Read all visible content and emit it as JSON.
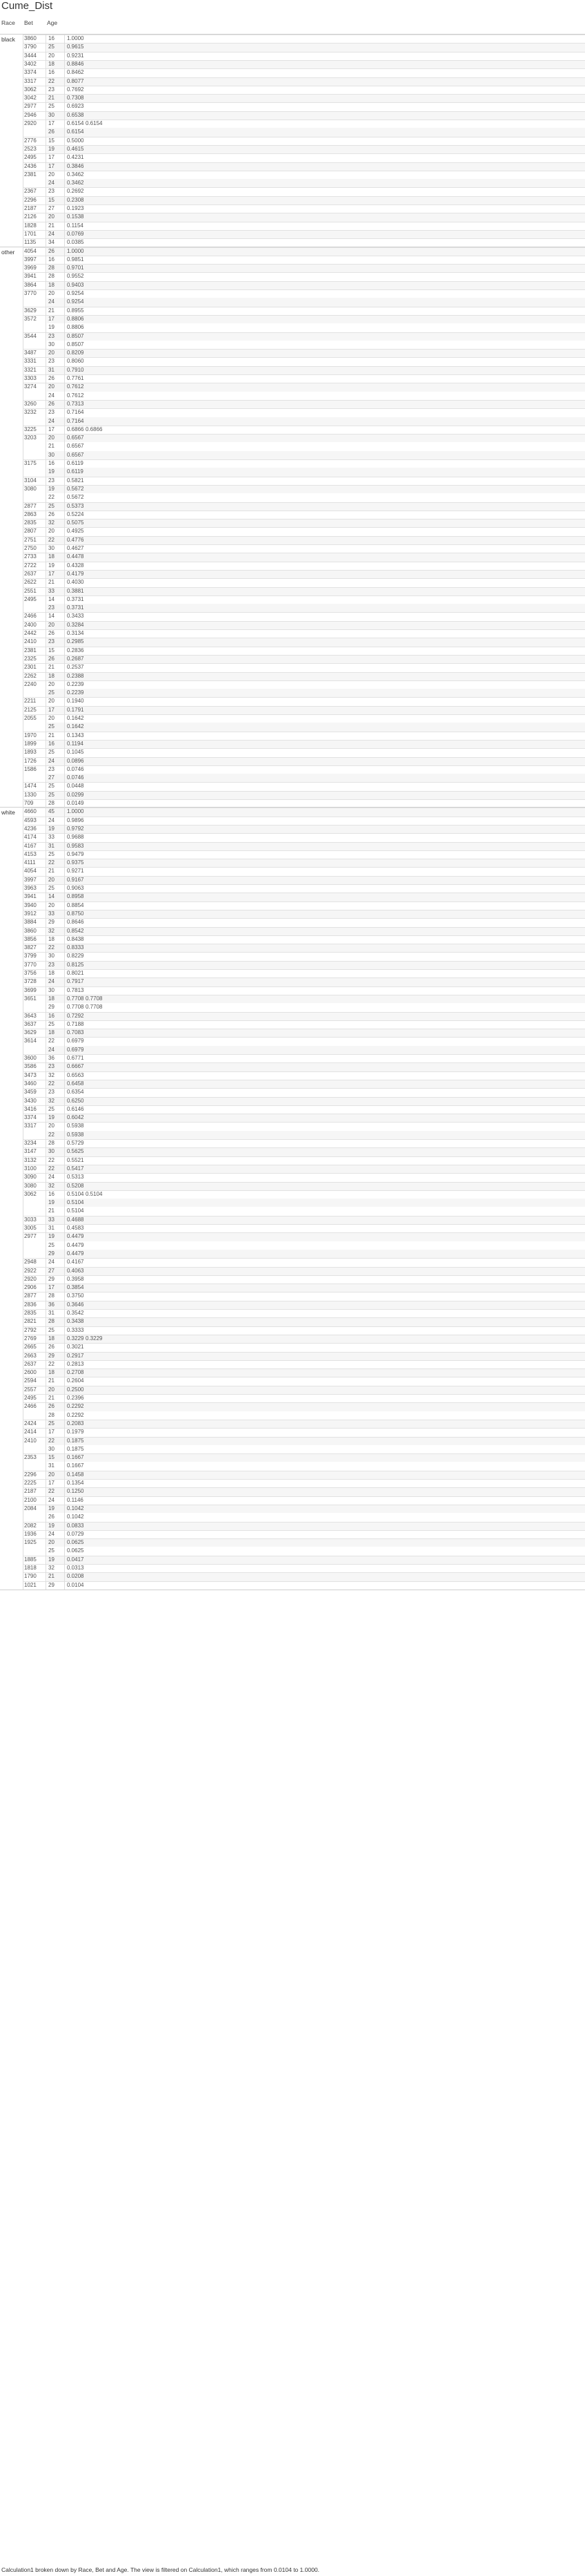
{
  "title": "Cume_Dist",
  "headers": {
    "race": "Race",
    "bet": "Bet",
    "age": "Age"
  },
  "groups": [
    {
      "race": "black",
      "rows": [
        [
          "3860",
          "16",
          "1.0000",
          ""
        ],
        [
          "3790",
          "25",
          "0.9615",
          ""
        ],
        [
          "3444",
          "20",
          "0.9231",
          ""
        ],
        [
          "3402",
          "18",
          "0.8846",
          ""
        ],
        [
          "3374",
          "16",
          "0.8462",
          ""
        ],
        [
          "3317",
          "22",
          "0.8077",
          ""
        ],
        [
          "3062",
          "23",
          "0.7692",
          ""
        ],
        [
          "3042",
          "21",
          "0.7308",
          ""
        ],
        [
          "2977",
          "25",
          "0.6923",
          ""
        ],
        [
          "2946",
          "30",
          "0.6538",
          ""
        ],
        [
          "2920",
          "17",
          "0.6154",
          "0.6154"
        ],
        [
          "",
          "26",
          "0.6154",
          ""
        ],
        [
          "2776",
          "15",
          "0.5000",
          ""
        ],
        [
          "2523",
          "19",
          "0.4615",
          ""
        ],
        [
          "2495",
          "17",
          "0.4231",
          ""
        ],
        [
          "2436",
          "17",
          "0.3846",
          ""
        ],
        [
          "2381",
          "20",
          "0.3462",
          ""
        ],
        [
          "",
          "24",
          "0.3462",
          ""
        ],
        [
          "2367",
          "23",
          "0.2692",
          ""
        ],
        [
          "2296",
          "15",
          "0.2308",
          ""
        ],
        [
          "2187",
          "27",
          "0.1923",
          ""
        ],
        [
          "2126",
          "20",
          "0.1538",
          ""
        ],
        [
          "1828",
          "21",
          "0.1154",
          ""
        ],
        [
          "1701",
          "24",
          "0.0769",
          ""
        ],
        [
          "1135",
          "34",
          "0.0385",
          ""
        ]
      ]
    },
    {
      "race": "other",
      "rows": [
        [
          "4054",
          "26",
          "1.0000",
          ""
        ],
        [
          "3997",
          "16",
          "0.9851",
          ""
        ],
        [
          "3969",
          "28",
          "0.9701",
          ""
        ],
        [
          "3941",
          "28",
          "0.9552",
          ""
        ],
        [
          "3864",
          "18",
          "0.9403",
          ""
        ],
        [
          "3770",
          "20",
          "0.9254",
          ""
        ],
        [
          "",
          "24",
          "0.9254",
          ""
        ],
        [
          "3629",
          "21",
          "0.8955",
          ""
        ],
        [
          "3572",
          "17",
          "0.8806",
          ""
        ],
        [
          "",
          "19",
          "0.8806",
          ""
        ],
        [
          "3544",
          "23",
          "0.8507",
          ""
        ],
        [
          "",
          "30",
          "0.8507",
          ""
        ],
        [
          "3487",
          "20",
          "0.8209",
          ""
        ],
        [
          "3331",
          "23",
          "0.8060",
          ""
        ],
        [
          "3321",
          "31",
          "0.7910",
          ""
        ],
        [
          "3303",
          "26",
          "0.7761",
          ""
        ],
        [
          "3274",
          "20",
          "0.7612",
          ""
        ],
        [
          "",
          "24",
          "0.7612",
          ""
        ],
        [
          "3260",
          "26",
          "0.7313",
          ""
        ],
        [
          "3232",
          "23",
          "0.7164",
          ""
        ],
        [
          "",
          "24",
          "0.7164",
          ""
        ],
        [
          "3225",
          "17",
          "0.6866",
          "0.6866"
        ],
        [
          "3203",
          "20",
          "0.6567",
          ""
        ],
        [
          "",
          "21",
          "0.6567",
          ""
        ],
        [
          "",
          "30",
          "0.6567",
          ""
        ],
        [
          "3175",
          "16",
          "0.6119",
          ""
        ],
        [
          "",
          "19",
          "0.6119",
          ""
        ],
        [
          "3104",
          "23",
          "0.5821",
          ""
        ],
        [
          "3080",
          "19",
          "0.5672",
          ""
        ],
        [
          "",
          "22",
          "0.5672",
          ""
        ],
        [
          "2877",
          "25",
          "0.5373",
          ""
        ],
        [
          "2863",
          "26",
          "0.5224",
          ""
        ],
        [
          "2835",
          "32",
          "0.5075",
          ""
        ],
        [
          "2807",
          "20",
          "0.4925",
          ""
        ],
        [
          "2751",
          "22",
          "0.4776",
          ""
        ],
        [
          "2750",
          "30",
          "0.4627",
          ""
        ],
        [
          "2733",
          "18",
          "0.4478",
          ""
        ],
        [
          "2722",
          "19",
          "0.4328",
          ""
        ],
        [
          "2637",
          "17",
          "0.4179",
          ""
        ],
        [
          "2622",
          "21",
          "0.4030",
          ""
        ],
        [
          "2551",
          "33",
          "0.3881",
          ""
        ],
        [
          "2495",
          "14",
          "0.3731",
          ""
        ],
        [
          "",
          "23",
          "0.3731",
          ""
        ],
        [
          "2466",
          "14",
          "0.3433",
          ""
        ],
        [
          "2400",
          "20",
          "0.3284",
          ""
        ],
        [
          "2442",
          "26",
          "0.3134",
          ""
        ],
        [
          "2410",
          "23",
          "0.2985",
          ""
        ],
        [
          "2381",
          "15",
          "0.2836",
          ""
        ],
        [
          "2325",
          "26",
          "0.2687",
          ""
        ],
        [
          "2301",
          "21",
          "0.2537",
          ""
        ],
        [
          "2262",
          "18",
          "0.2388",
          ""
        ],
        [
          "2240",
          "20",
          "0.2239",
          ""
        ],
        [
          "",
          "25",
          "0.2239",
          ""
        ],
        [
          "2211",
          "20",
          "0.1940",
          ""
        ],
        [
          "2125",
          "17",
          "0.1791",
          ""
        ],
        [
          "2055",
          "20",
          "0.1642",
          ""
        ],
        [
          "",
          "25",
          "0.1642",
          ""
        ],
        [
          "1970",
          "21",
          "0.1343",
          ""
        ],
        [
          "1899",
          "16",
          "0.1194",
          ""
        ],
        [
          "1893",
          "25",
          "0.1045",
          ""
        ],
        [
          "1726",
          "24",
          "0.0896",
          ""
        ],
        [
          "1586",
          "23",
          "0.0746",
          ""
        ],
        [
          "",
          "27",
          "0.0746",
          ""
        ],
        [
          "1474",
          "25",
          "0.0448",
          ""
        ],
        [
          "1330",
          "25",
          "0.0299",
          ""
        ],
        [
          "709",
          "28",
          "0.0149",
          ""
        ]
      ]
    },
    {
      "race": "white",
      "rows": [
        [
          "4660",
          "45",
          "1.0000",
          ""
        ],
        [
          "4593",
          "24",
          "0.9896",
          ""
        ],
        [
          "4236",
          "19",
          "0.9792",
          ""
        ],
        [
          "4174",
          "33",
          "0.9688",
          ""
        ],
        [
          "4167",
          "31",
          "0.9583",
          ""
        ],
        [
          "4153",
          "25",
          "0.9479",
          ""
        ],
        [
          "4111",
          "22",
          "0.9375",
          ""
        ],
        [
          "4054",
          "21",
          "0.9271",
          ""
        ],
        [
          "3997",
          "20",
          "0.9167",
          ""
        ],
        [
          "3963",
          "25",
          "0.9063",
          ""
        ],
        [
          "3941",
          "14",
          "0.8958",
          ""
        ],
        [
          "3940",
          "20",
          "0.8854",
          ""
        ],
        [
          "3912",
          "33",
          "0.8750",
          ""
        ],
        [
          "3884",
          "29",
          "0.8646",
          ""
        ],
        [
          "3860",
          "32",
          "0.8542",
          ""
        ],
        [
          "3856",
          "18",
          "0.8438",
          ""
        ],
        [
          "3827",
          "22",
          "0.8333",
          ""
        ],
        [
          "3799",
          "30",
          "0.8229",
          ""
        ],
        [
          "3770",
          "23",
          "0.8125",
          ""
        ],
        [
          "3756",
          "18",
          "0.8021",
          ""
        ],
        [
          "3728",
          "24",
          "0.7917",
          ""
        ],
        [
          "3699",
          "30",
          "0.7813",
          ""
        ],
        [
          "3651",
          "18",
          "0.7708",
          "0.7708"
        ],
        [
          "",
          "29",
          "0.7708",
          "0.7708"
        ],
        [
          "3643",
          "16",
          "0.7292",
          ""
        ],
        [
          "3637",
          "25",
          "0.7188",
          ""
        ],
        [
          "3629",
          "18",
          "0.7083",
          ""
        ],
        [
          "3614",
          "22",
          "0.6979",
          ""
        ],
        [
          "",
          "24",
          "0.6979",
          ""
        ],
        [
          "3600",
          "36",
          "0.6771",
          ""
        ],
        [
          "3586",
          "23",
          "0.6667",
          ""
        ],
        [
          "3473",
          "32",
          "0.6563",
          ""
        ],
        [
          "3460",
          "22",
          "0.6458",
          ""
        ],
        [
          "3459",
          "23",
          "0.6354",
          ""
        ],
        [
          "3430",
          "32",
          "0.6250",
          ""
        ],
        [
          "3416",
          "25",
          "0.6146",
          ""
        ],
        [
          "3374",
          "19",
          "0.6042",
          ""
        ],
        [
          "3317",
          "20",
          "0.5938",
          ""
        ],
        [
          "",
          "22",
          "0.5938",
          ""
        ],
        [
          "3234",
          "28",
          "0.5729",
          ""
        ],
        [
          "3147",
          "30",
          "0.5625",
          ""
        ],
        [
          "3132",
          "22",
          "0.5521",
          ""
        ],
        [
          "3100",
          "22",
          "0.5417",
          ""
        ],
        [
          "3090",
          "24",
          "0.5313",
          ""
        ],
        [
          "3080",
          "32",
          "0.5208",
          ""
        ],
        [
          "3062",
          "16",
          "0.5104",
          "0.5104"
        ],
        [
          "",
          "19",
          "0.5104",
          ""
        ],
        [
          "",
          "21",
          "0.5104",
          ""
        ],
        [
          "3033",
          "33",
          "0.4688",
          ""
        ],
        [
          "3005",
          "31",
          "0.4583",
          ""
        ],
        [
          "2977",
          "19",
          "0.4479",
          ""
        ],
        [
          "",
          "25",
          "0.4479",
          ""
        ],
        [
          "",
          "29",
          "0.4479",
          ""
        ],
        [
          "2948",
          "24",
          "0.4167",
          ""
        ],
        [
          "2922",
          "27",
          "0.4063",
          ""
        ],
        [
          "2920",
          "29",
          "0.3958",
          ""
        ],
        [
          "2906",
          "17",
          "0.3854",
          ""
        ],
        [
          "2877",
          "28",
          "0.3750",
          ""
        ],
        [
          "2836",
          "36",
          "0.3646",
          ""
        ],
        [
          "2835",
          "31",
          "0.3542",
          ""
        ],
        [
          "2821",
          "28",
          "0.3438",
          ""
        ],
        [
          "2792",
          "25",
          "0.3333",
          ""
        ],
        [
          "2769",
          "18",
          "0.3229",
          "0.3229"
        ],
        [
          "2665",
          "26",
          "0.3021",
          ""
        ],
        [
          "2663",
          "29",
          "0.2917",
          ""
        ],
        [
          "2637",
          "22",
          "0.2813",
          ""
        ],
        [
          "2600",
          "18",
          "0.2708",
          ""
        ],
        [
          "2594",
          "21",
          "0.2604",
          ""
        ],
        [
          "2557",
          "20",
          "0.2500",
          ""
        ],
        [
          "2495",
          "21",
          "0.2396",
          ""
        ],
        [
          "2466",
          "26",
          "0.2292",
          ""
        ],
        [
          "",
          "28",
          "0.2292",
          ""
        ],
        [
          "2424",
          "25",
          "0.2083",
          ""
        ],
        [
          "2414",
          "17",
          "0.1979",
          ""
        ],
        [
          "2410",
          "22",
          "0.1875",
          ""
        ],
        [
          "",
          "30",
          "0.1875",
          ""
        ],
        [
          "2353",
          "15",
          "0.1667",
          ""
        ],
        [
          "",
          "31",
          "0.1667",
          ""
        ],
        [
          "2296",
          "20",
          "0.1458",
          ""
        ],
        [
          "2225",
          "17",
          "0.1354",
          ""
        ],
        [
          "2187",
          "22",
          "0.1250",
          ""
        ],
        [
          "2100",
          "24",
          "0.1146",
          ""
        ],
        [
          "2084",
          "19",
          "0.1042",
          ""
        ],
        [
          "",
          "26",
          "0.1042",
          ""
        ],
        [
          "2082",
          "19",
          "0.0833",
          ""
        ],
        [
          "1936",
          "24",
          "0.0729",
          ""
        ],
        [
          "1925",
          "20",
          "0.0625",
          ""
        ],
        [
          "",
          "25",
          "0.0625",
          ""
        ],
        [
          "1885",
          "19",
          "0.0417",
          ""
        ],
        [
          "1818",
          "32",
          "0.0313",
          ""
        ],
        [
          "1790",
          "21",
          "0.0208",
          ""
        ],
        [
          "1021",
          "29",
          "0.0104",
          ""
        ]
      ]
    }
  ],
  "caption": "Calculation1 broken down by Race, Bet and Age.  The view is filtered on Calculation1, which ranges from 0.0104 to 1.0000."
}
